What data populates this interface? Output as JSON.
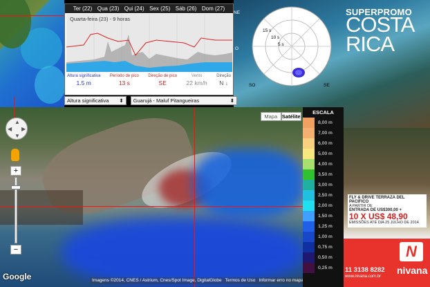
{
  "forecast": {
    "days": [
      "Ter (22)",
      "Qua (23)",
      "Qui (24)",
      "Sex (25)",
      "Sáb (26)",
      "Dom (27)"
    ],
    "graph_title": "Quarta-feira (23) - 9 horas",
    "stats": [
      {
        "label": "Altura significativa",
        "value": "1.5 m",
        "color": "#2233cc"
      },
      {
        "label": "Período de pico",
        "value": "13 s",
        "color": "#cc2222"
      },
      {
        "label": "Direção de pico",
        "value": "SE",
        "color": "#cc2222"
      },
      {
        "label": "Vento",
        "value": "22 km/h",
        "color": "#888888"
      },
      {
        "label": "Direção",
        "value": "N",
        "color": "#555555"
      }
    ]
  },
  "polar": {
    "rings": [
      "15 s",
      "10 s",
      "5 s"
    ],
    "compass": {
      "ne": "NE",
      "n": "N",
      "e": "E",
      "so": "SO",
      "se": "SE",
      "o": "O"
    }
  },
  "selectors": {
    "parameter": "Altura significativa",
    "location": "Guarujá - Maluf Pitangueiras"
  },
  "map": {
    "map_label": "Mapa",
    "satellite_label": "Satélite",
    "attribution": [
      "Imagens ©2014, CNES / Astrium, Cnes/Spot Image, DigitalGlobe",
      "Termos de Uso",
      "Informar erro no mapa"
    ],
    "google": "Google"
  },
  "scale": {
    "title": "ESCALA",
    "levels": [
      {
        "label": "8,00 m",
        "color": "#f0a060"
      },
      {
        "label": "7,00 m",
        "color": "#f4b070"
      },
      {
        "label": "6,00 m",
        "color": "#f8d080"
      },
      {
        "label": "5,00 m",
        "color": "#f8e880"
      },
      {
        "label": "4,00 m",
        "color": "#a8e070"
      },
      {
        "label": "3,50 m",
        "color": "#30c030"
      },
      {
        "label": "3,00 m",
        "color": "#20b0a0"
      },
      {
        "label": "2,50 m",
        "color": "#20c0e0"
      },
      {
        "label": "2,00 m",
        "color": "#20e0f0"
      },
      {
        "label": "1,50 m",
        "color": "#40a0ff"
      },
      {
        "label": "1,25 m",
        "color": "#2060e8"
      },
      {
        "label": "1,00 m",
        "color": "#1848c8"
      },
      {
        "label": "0,75 m",
        "color": "#1030a0"
      },
      {
        "label": "0,50 m",
        "color": "#201870"
      },
      {
        "label": "0,25 m",
        "color": "#401040"
      }
    ]
  },
  "ad": {
    "superpromo": "SUPERPROMO",
    "title": "COSTA RICA",
    "fly_line": "FLY & DRIVE TERRAZA DEL PACIFICO",
    "from": "A PARTIR DE",
    "entry": "ENTRADA DE US$300,00 +",
    "installments": "10 X US$ 48,90",
    "deadline": "EMISSÕES ATÉ DIA 25 JULHO DE 2014",
    "phone": "11 3138 8282",
    "site": "www.nivana.com.br",
    "brand": "nivana",
    "logo_letter": "N"
  }
}
